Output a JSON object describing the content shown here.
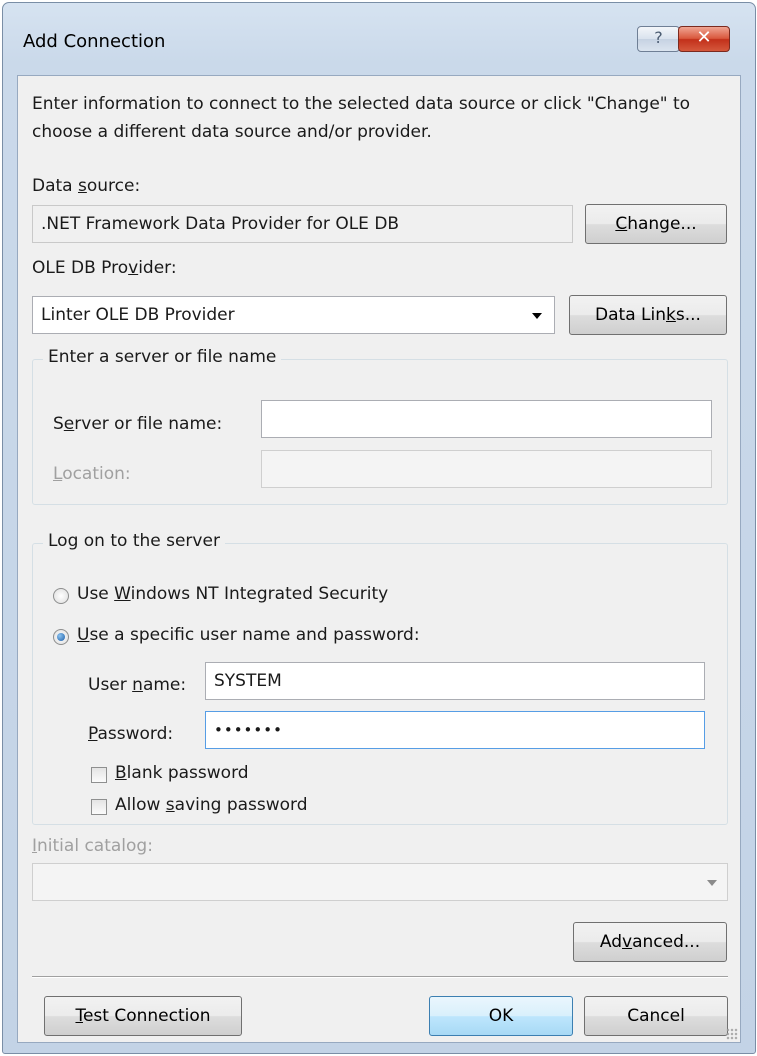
{
  "window": {
    "title": "Add Connection",
    "help_glyph": "?",
    "close_glyph": "✕"
  },
  "instructions": "Enter information to connect to the selected data source or click \"Change\" to choose a different data source and/or provider.",
  "data_source": {
    "label_pre": "Data ",
    "label_key": "s",
    "label_post": "ource:",
    "value": ".NET Framework Data Provider for OLE DB",
    "change_pre": "",
    "change_key": "C",
    "change_post": "hange..."
  },
  "provider": {
    "label_pre": "OLE DB Pro",
    "label_key": "v",
    "label_post": "ider:",
    "selected": "Linter OLE DB Provider",
    "data_links_pre": "Data Lin",
    "data_links_key": "k",
    "data_links_post": "s..."
  },
  "server_group": {
    "legend": "Enter a server or file name",
    "server_label_pre": "S",
    "server_label_key": "e",
    "server_label_post": "rver or file name:",
    "server_value": "",
    "location_label_pre": "",
    "location_label_key": "L",
    "location_label_post": "ocation:",
    "location_value": ""
  },
  "logon_group": {
    "legend": "Log on to the server",
    "windows_pre": "Use ",
    "windows_key": "W",
    "windows_post": "indows NT Integrated Security",
    "windows_selected": false,
    "specific_pre": "",
    "specific_key": "U",
    "specific_post": "se a specific user name and password:",
    "specific_selected": true,
    "user_label_pre": "User ",
    "user_label_key": "n",
    "user_label_post": "ame:",
    "user_value": "SYSTEM",
    "password_label_pre": "",
    "password_label_key": "P",
    "password_label_post": "assword:",
    "password_value": "•••••••",
    "blank_pre": "",
    "blank_key": "B",
    "blank_post": "lank password",
    "blank_checked": false,
    "saving_pre": "Allow ",
    "saving_key": "s",
    "saving_post": "aving password",
    "saving_checked": false
  },
  "catalog": {
    "label_pre": "",
    "label_key": "I",
    "label_post": "nitial catalog:",
    "value": ""
  },
  "buttons": {
    "advanced_pre": "Ad",
    "advanced_key": "v",
    "advanced_post": "anced...",
    "test_pre": "",
    "test_key": "T",
    "test_post": "est Connection",
    "ok": "OK",
    "cancel": "Cancel"
  }
}
